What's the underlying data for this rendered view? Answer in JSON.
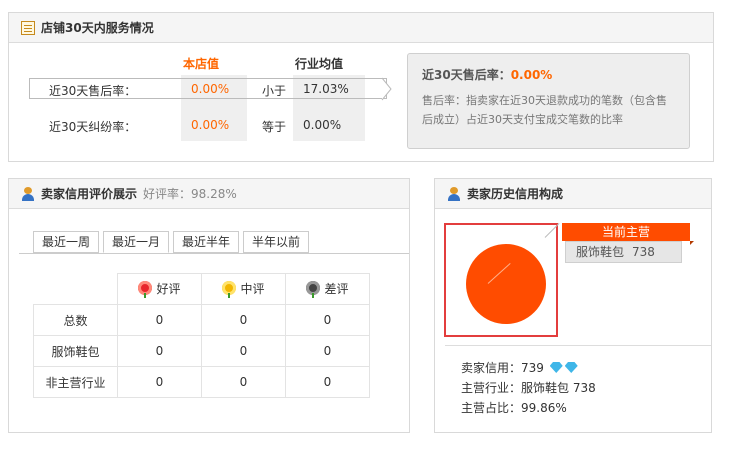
{
  "service": {
    "title": "店铺30天内服务情况",
    "col_store": "本店值",
    "col_industry": "行业均值",
    "rows": [
      {
        "label": "近30天售后率：",
        "store": "0.00%",
        "compare": "小于",
        "industry": "17.03%"
      },
      {
        "label": "近30天纠纷率：",
        "store": "0.00%",
        "compare": "等于",
        "industry": "0.00%"
      }
    ],
    "tip": {
      "title": "近30天售后率：",
      "value": "0.00%",
      "text": "售后率：指卖家在近30天退款成功的笔数（包含售后成立）占近30天支付宝成交笔数的比率"
    }
  },
  "credit": {
    "title": "卖家信用评价展示",
    "good_rate_label": "好评率：98.28%",
    "tabs": [
      "最近一周",
      "最近一月",
      "最近半年",
      "半年以前"
    ],
    "active_tab": 1,
    "headers": [
      "好评",
      "中评",
      "差评"
    ],
    "rows": [
      {
        "label": "总数",
        "values": [
          "0",
          "0",
          "0"
        ]
      },
      {
        "label": "服饰鞋包",
        "values": [
          "0",
          "0",
          "0"
        ],
        "highlight": true
      },
      {
        "label": "非主营行业",
        "values": [
          "0",
          "0",
          "0"
        ]
      }
    ],
    "colors": {
      "highlight": "#ff6600"
    }
  },
  "history": {
    "title": "卖家历史信用构成",
    "legend_head": "当前主营",
    "legend_name": "服饰鞋包",
    "legend_value": "738",
    "share_fraction": 0.9986,
    "seller_credit": "卖家信用：739",
    "main_industry": "主营行业：服饰鞋包 738",
    "main_share": "主营占比：99.86%",
    "colors": {
      "pie": "#ff4c00",
      "frame": "#e33d3d"
    }
  }
}
